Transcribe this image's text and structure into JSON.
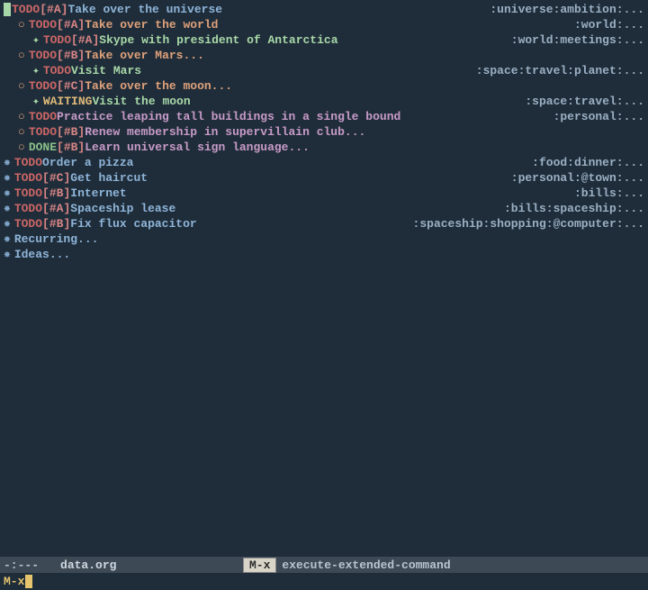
{
  "lines": [
    {
      "indent": 0,
      "first": true,
      "bullet": "",
      "keyword": "TODO",
      "kwcls": "todo-kw",
      "priority": "[#A]",
      "title": "Take over the universe",
      "titlecls": "heading-l0",
      "tags": ":universe:ambition:..."
    },
    {
      "indent": 1,
      "bullet": "○",
      "bulletcls": "bullet-o-l1",
      "keyword": "TODO",
      "kwcls": "todo-kw",
      "priority": "[#A]",
      "title": "Take over the world",
      "titlecls": "heading-l1",
      "tags": ":world:..."
    },
    {
      "indent": 2,
      "bullet": "✦",
      "bulletcls": "bullet-star-l2",
      "keyword": "TODO",
      "kwcls": "todo-kw",
      "priority": "[#A]",
      "title": "Skype with president of Antarctica",
      "titlecls": "heading-l2",
      "tags": ":world:meetings:..."
    },
    {
      "indent": 1,
      "bullet": "○",
      "bulletcls": "bullet-o-l1",
      "keyword": "TODO",
      "kwcls": "todo-kw",
      "priority": "[#B]",
      "title": "Take over Mars...",
      "titlecls": "heading-l1",
      "tags": ""
    },
    {
      "indent": 2,
      "bullet": "✦",
      "bulletcls": "bullet-star-l2",
      "keyword": "TODO",
      "kwcls": "todo-kw",
      "priority": "",
      "title": "Visit Mars",
      "titlecls": "heading-l2",
      "tags": ":space:travel:planet:..."
    },
    {
      "indent": 1,
      "bullet": "○",
      "bulletcls": "bullet-o-l1",
      "keyword": "TODO",
      "kwcls": "todo-kw",
      "priority": "[#C]",
      "title": "Take over the moon...",
      "titlecls": "heading-l1",
      "tags": ""
    },
    {
      "indent": 2,
      "bullet": "✦",
      "bulletcls": "bullet-star-l2",
      "keyword": "WAITING",
      "kwcls": "waiting-kw",
      "priority": "",
      "title": "Visit the moon",
      "titlecls": "heading-l2",
      "tags": ":space:travel:..."
    },
    {
      "indent": 1,
      "bullet": "○",
      "bulletcls": "bullet-o-l1",
      "keyword": "TODO",
      "kwcls": "todo-kw",
      "priority": "",
      "title": "Practice leaping tall buildings in a single bound",
      "titlecls": "heading-sub",
      "tags": ":personal:..."
    },
    {
      "indent": 1,
      "bullet": "○",
      "bulletcls": "bullet-o-l1",
      "keyword": "TODO",
      "kwcls": "todo-kw",
      "priority": "[#B]",
      "title": "Renew membership in supervillain club...",
      "titlecls": "heading-sub",
      "tags": ""
    },
    {
      "indent": 1,
      "bullet": "○",
      "bulletcls": "bullet-o-l1",
      "keyword": "DONE",
      "kwcls": "done-kw",
      "priority": "[#B]",
      "title": "Learn universal sign language...",
      "titlecls": "heading-sub",
      "tags": ""
    },
    {
      "indent": 0,
      "bullet": "✸",
      "bulletcls": "bullet-star-l0",
      "keyword": "TODO",
      "kwcls": "todo-kw",
      "priority": "",
      "title": "Order a pizza",
      "titlecls": "heading-l0",
      "tags": ":food:dinner:..."
    },
    {
      "indent": 0,
      "bullet": "✸",
      "bulletcls": "bullet-star-l0",
      "keyword": "TODO",
      "kwcls": "todo-kw",
      "priority": "[#C]",
      "title": "Get haircut",
      "titlecls": "heading-l0",
      "tags": ":personal:@town:..."
    },
    {
      "indent": 0,
      "bullet": "✸",
      "bulletcls": "bullet-star-l0",
      "keyword": "TODO",
      "kwcls": "todo-kw",
      "priority": "[#B]",
      "title": "Internet",
      "titlecls": "heading-l0",
      "tags": ":bills:..."
    },
    {
      "indent": 0,
      "bullet": "✸",
      "bulletcls": "bullet-star-l0",
      "keyword": "TODO",
      "kwcls": "todo-kw",
      "priority": "[#A]",
      "title": "Spaceship lease",
      "titlecls": "heading-l0",
      "tags": ":bills:spaceship:..."
    },
    {
      "indent": 0,
      "bullet": "✸",
      "bulletcls": "bullet-star-l0",
      "keyword": "TODO",
      "kwcls": "todo-kw",
      "priority": "[#B]",
      "title": "Fix flux capacitor",
      "titlecls": "heading-l0",
      "tags": ":spaceship:shopping:@computer:..."
    },
    {
      "indent": 0,
      "bullet": "✸",
      "bulletcls": "bullet-star-l0",
      "keyword": "",
      "kwcls": "",
      "priority": "",
      "title": "Recurring...",
      "titlecls": "heading-l0",
      "tags": ""
    },
    {
      "indent": 0,
      "bullet": "✸",
      "bulletcls": "bullet-star-l0",
      "keyword": "",
      "kwcls": "",
      "priority": "",
      "title": "Ideas...",
      "titlecls": "heading-l0",
      "tags": ""
    }
  ],
  "modeline": {
    "status": "-:---",
    "filename": "data.org",
    "mx_label": "M-x",
    "command": "execute-extended-command"
  },
  "minibuffer": {
    "prompt": "M-x"
  }
}
